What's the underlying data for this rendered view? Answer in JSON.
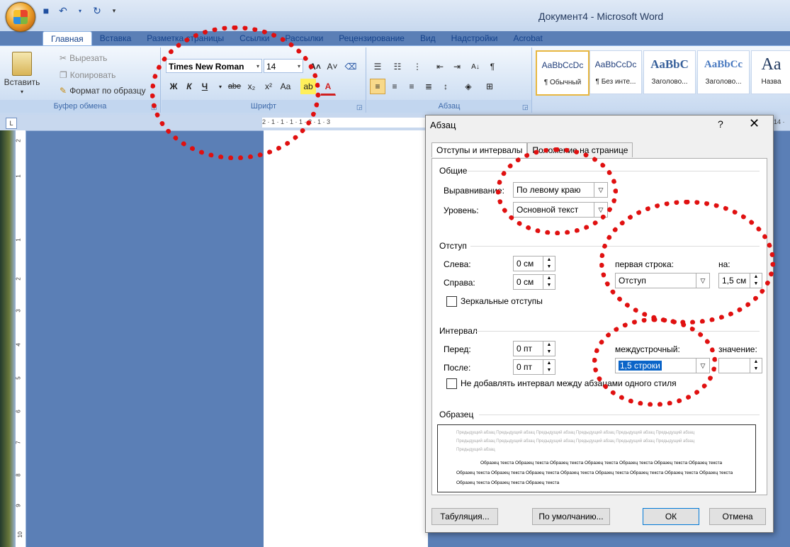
{
  "window": {
    "title": "Документ4 - Microsoft Word"
  },
  "tabs": [
    "Главная",
    "Вставка",
    "Разметка страницы",
    "Ссылки",
    "Рассылки",
    "Рецензирование",
    "Вид",
    "Надстройки",
    "Acrobat"
  ],
  "ribbon": {
    "clipboard": {
      "paste": "Вставить",
      "cut": "Вырезать",
      "copy": "Копировать",
      "format_painter": "Формат по образцу",
      "label": "Буфер обмена"
    },
    "font": {
      "font_name": "Times New Roman",
      "font_size": "14",
      "bold": "Ж",
      "italic": "К",
      "underline": "Ч",
      "strike": "abe",
      "sub": "x₂",
      "sup": "x²",
      "case": "Aa",
      "label": "Шрифт"
    },
    "paragraph": {
      "label": "Абзац"
    },
    "styles": [
      {
        "sample": "AaBbCcDc",
        "name": "¶ Обычный"
      },
      {
        "sample": "AaBbCcDc",
        "name": "¶ Без инте..."
      },
      {
        "sample": "AaBbC",
        "name": "Заголово..."
      },
      {
        "sample": "AaBbCc",
        "name": "Заголово..."
      },
      {
        "sample": "Aa",
        "name": "Назва"
      }
    ]
  },
  "ruler": {
    "corner": "L",
    "marks": "2 · 1 · 1 · 1 · 1 · 2 · 1 · 3",
    "right_mark": "14 ·"
  },
  "dialog": {
    "title": "Абзац",
    "help": "?",
    "close": "✕",
    "tabs": [
      "Отступы и интервалы",
      "Положение на странице"
    ],
    "general": {
      "label": "Общие",
      "alignment_label": "Выравнивание:",
      "alignment_value": "По левому краю",
      "level_label": "Уровень:",
      "level_value": "Основной текст"
    },
    "indent": {
      "label": "Отступ",
      "left_label": "Слева:",
      "left_value": "0 см",
      "right_label": "Справа:",
      "right_value": "0 см",
      "mirror_label": "Зеркальные отступы",
      "first_line_label": "первая строка:",
      "first_line_value": "Отступ",
      "by_label": "на:",
      "by_value": "1,5 см"
    },
    "spacing": {
      "label": "Интервал",
      "before_label": "Перед:",
      "before_value": "0 пт",
      "after_label": "После:",
      "after_value": "0 пт",
      "no_add_label": "Не добавлять интервал между абзацами одного стиля",
      "line_label": "междустрочный:",
      "line_value": "1,5 строки",
      "value_label": "значение:",
      "value_value": ""
    },
    "preview": {
      "label": "Образец",
      "prev_lines": [
        "Предыдущий абзац Предыдущий абзац Предыдущий абзац Предыдущий абзац Предыдущий абзац Предыдущий абзац",
        "Предыдущий абзац Предыдущий абзац Предыдущий абзац Предыдущий абзац Предыдущий абзац Предыдущий абзац",
        "Предыдущий абзац"
      ],
      "sample_lines": [
        "Образец текста Образец текста Образец текста Образец текста Образец текста Образец текста Образец текста",
        "Образец текста Образец текста Образец текста Образец текста Образец текста Образец текста Образец текста Образец текста",
        "Образец текста Образец текста Образец текста"
      ]
    },
    "buttons": {
      "tabs": "Табуляция...",
      "default": "По умолчанию...",
      "ok": "ОК",
      "cancel": "Отмена"
    }
  },
  "vruler_marks": [
    "2",
    "1",
    "1",
    "2",
    "3",
    "4",
    "5",
    "6",
    "7",
    "8",
    "9",
    "10"
  ]
}
